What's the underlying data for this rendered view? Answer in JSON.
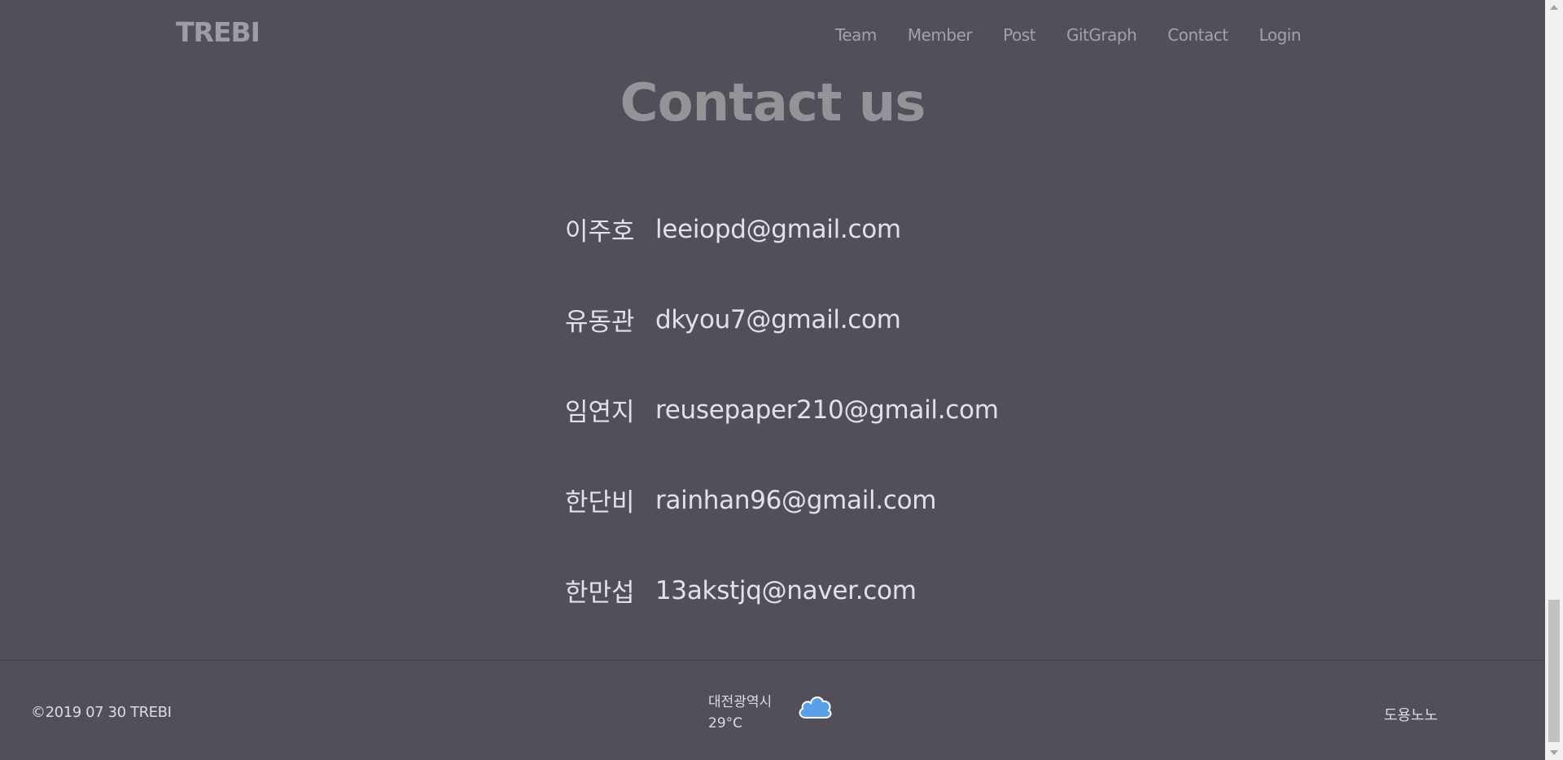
{
  "nav": {
    "brand": "TREBI",
    "links": [
      "Team",
      "Member",
      "Post",
      "GitGraph",
      "Contact",
      "Login"
    ]
  },
  "main": {
    "title": "Contact us",
    "contacts": [
      {
        "name": "이주호",
        "email": "leeiopd@gmail.com"
      },
      {
        "name": "유동관",
        "email": "dkyou7@gmail.com"
      },
      {
        "name": "임연지",
        "email": "reusepaper210@gmail.com"
      },
      {
        "name": "한단비",
        "email": "rainhan96@gmail.com"
      },
      {
        "name": "한만섭",
        "email": "13akstjq@naver.com"
      }
    ]
  },
  "footer": {
    "copyright": "©2019 07 30 TREBI",
    "weather": {
      "city": "대전광역시",
      "temperature": "29°C",
      "icon": "cloud-icon"
    },
    "right_text": "도용노노"
  },
  "colors": {
    "background": "#524f5a",
    "nav_text": "#a4a1a8",
    "title": "#969398",
    "body_text": "#e3e1e6",
    "weather_icon": "#4a90e2"
  }
}
